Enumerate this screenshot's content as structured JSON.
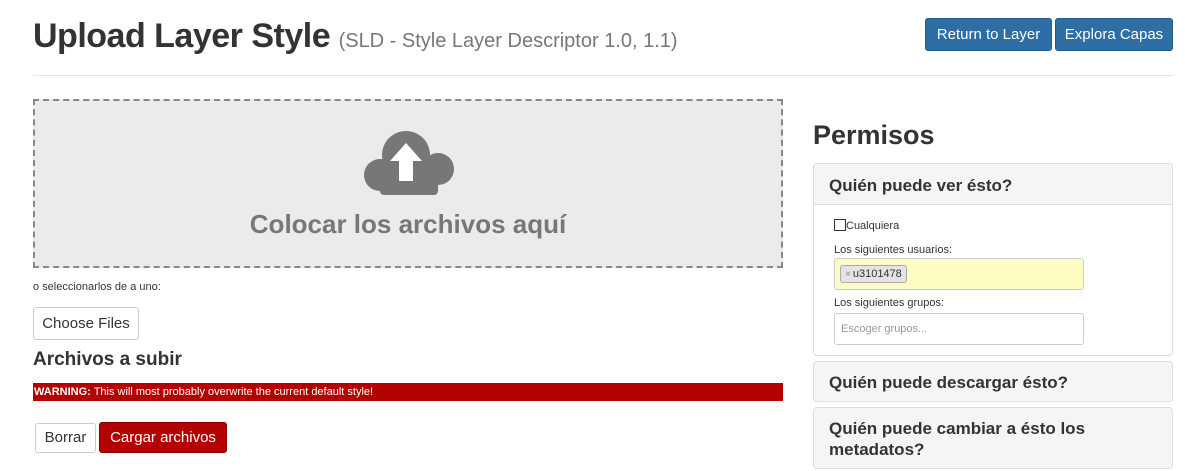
{
  "header": {
    "title": "Upload Layer Style",
    "subtitle": "(SLD - Style Layer Descriptor 1.0, 1.1)",
    "return_label": "Return to Layer",
    "explore_label": "Explora Capas"
  },
  "dropzone": {
    "text": "Colocar los archivos aquí",
    "icon": "cloud-upload-icon"
  },
  "upload": {
    "select_text": "o seleccionarlos de a uno:",
    "choose_label": "Choose Files",
    "files_heading": "Archivos a subir",
    "warning_label": "WARNING:",
    "warning_text": "This will most probably overwrite the current default style!",
    "clear_label": "Borrar",
    "upload_label": "Cargar archivos"
  },
  "permissions": {
    "title": "Permisos",
    "view": {
      "heading": "Quién puede ver ésto?",
      "anyone_label": "Cualquiera",
      "anyone_checked": false,
      "users_label": "Los siguientes usuarios:",
      "users": [
        "u3101478"
      ],
      "groups_label": "Los siguientes grupos:",
      "groups_placeholder": "Escoger grupos..."
    },
    "download_heading": "Quién puede descargar ésto?",
    "metadata_heading": "Quién puede cambiar a ésto los metadatos?"
  },
  "colors": {
    "primary": "#2c6ea5",
    "danger": "#b30000",
    "highlight": "#fdfdc2"
  }
}
